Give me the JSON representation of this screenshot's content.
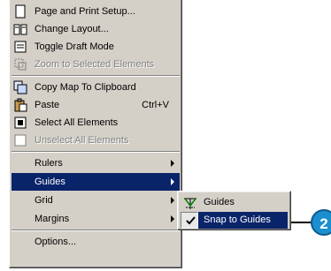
{
  "menu": {
    "items": [
      {
        "label": "Page and Print Setup...",
        "icon": "page-setup-icon",
        "disabled": false
      },
      {
        "label": "Change Layout...",
        "icon": "change-layout-icon",
        "disabled": false
      },
      {
        "label": "Toggle Draft Mode",
        "icon": "draft-mode-icon",
        "disabled": false
      },
      {
        "label": "Zoom to Selected Elements",
        "icon": "zoom-selected-icon",
        "disabled": true
      },
      {
        "label": "Copy Map To Clipboard",
        "icon": "copy-map-icon",
        "disabled": false
      },
      {
        "label": "Paste",
        "shortcut": "Ctrl+V",
        "icon": "paste-icon",
        "disabled": false
      },
      {
        "label": "Select All Elements",
        "icon": "select-all-icon",
        "disabled": false
      },
      {
        "label": "Unselect All Elements",
        "icon": "unselect-all-icon",
        "disabled": true
      },
      {
        "label": "Rulers",
        "submenu": true
      },
      {
        "label": "Guides",
        "submenu": true,
        "selected": true
      },
      {
        "label": "Grid",
        "submenu": true
      },
      {
        "label": "Margins",
        "submenu": true
      },
      {
        "label": "Options..."
      }
    ]
  },
  "submenu": {
    "items": [
      {
        "label": "Guides",
        "icon": "guides-icon"
      },
      {
        "label": "Snap to Guides",
        "icon": "check-icon",
        "checked": true,
        "selected": true
      }
    ]
  },
  "callout": {
    "number": "2"
  },
  "colors": {
    "menu_bg": "#d4d0c8",
    "highlight": "#0a246a",
    "callout": "#1b8fd0"
  }
}
